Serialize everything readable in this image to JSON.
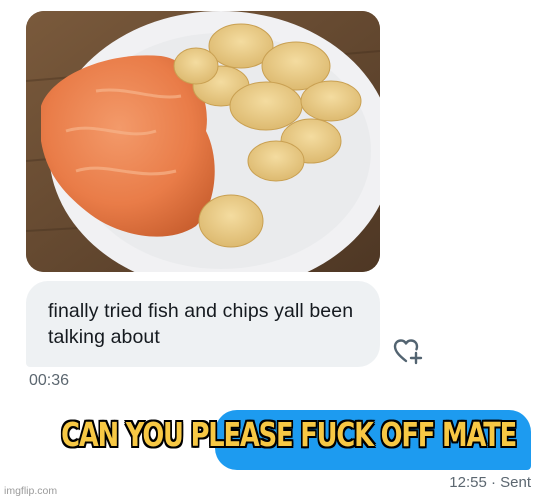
{
  "incoming": {
    "text": "finally tried fish and chips yall been talking about",
    "time": "00:36"
  },
  "outgoing": {
    "time": "12:55 · Sent"
  },
  "overlay": {
    "caption": "CAN YOU PLEASE FUCK OFF MATE"
  },
  "watermark": "imgflip.com",
  "icons": {
    "react": "heart-plus-icon"
  },
  "colors": {
    "outgoing_bubble": "#1d9bf0",
    "incoming_bubble": "#eef1f3",
    "caption_fill": "#f7c844",
    "caption_stroke": "#000000"
  }
}
